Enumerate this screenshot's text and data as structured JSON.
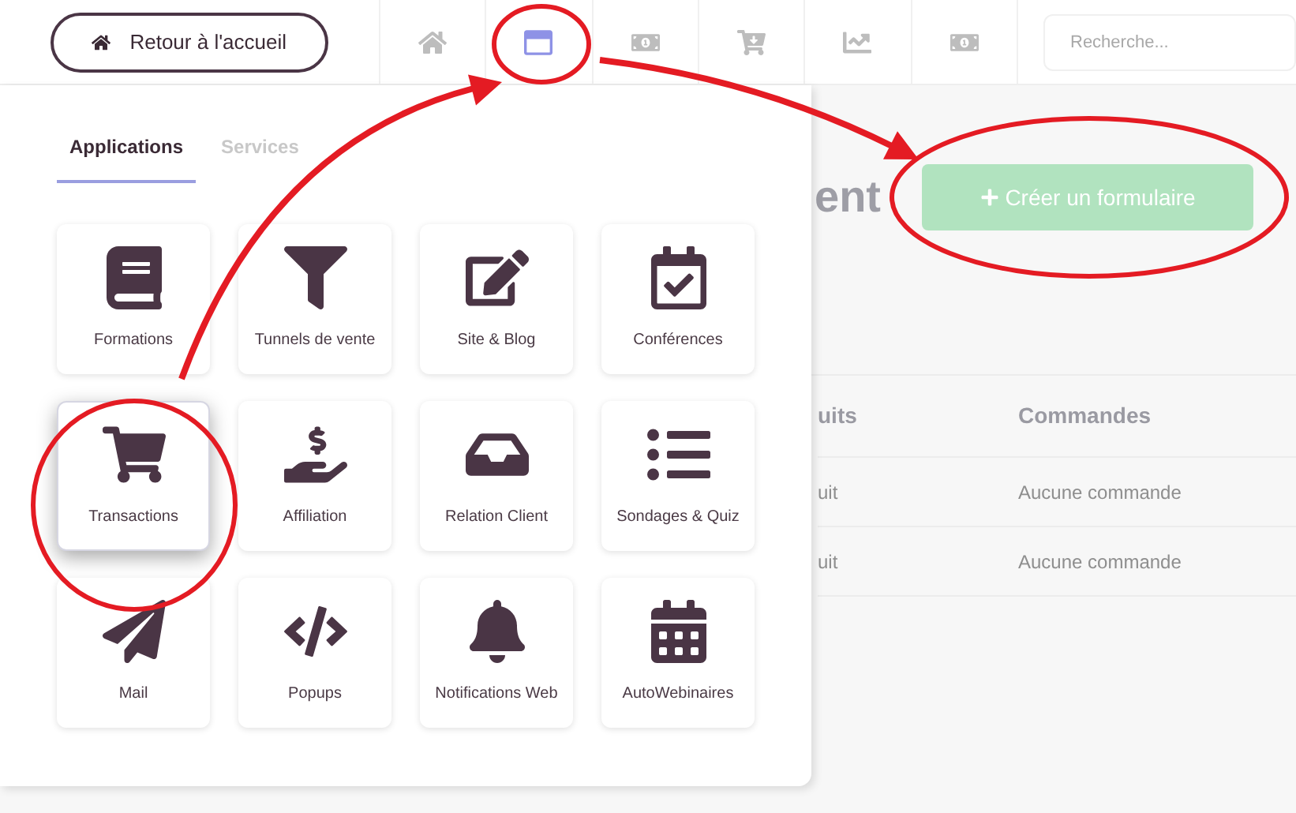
{
  "topbar": {
    "back_button": "Retour à l'accueil",
    "nav": [
      {
        "selected": false
      },
      {
        "selected": true
      },
      {
        "selected": false
      },
      {
        "selected": false
      },
      {
        "selected": false
      },
      {
        "selected": false
      }
    ],
    "search": {
      "placeholder": "Recherche..."
    }
  },
  "page": {
    "heading": "ent",
    "create_button": "Créer un formulaire",
    "columns": [
      "uits",
      "Commandes"
    ],
    "rows": [
      [
        "uit",
        "Aucune commande"
      ],
      [
        "uit",
        "Aucune commande"
      ]
    ]
  },
  "menu": {
    "tabs": [
      {
        "label": "Applications",
        "selected": true
      },
      {
        "label": "Services",
        "selected": false
      }
    ],
    "apps": [
      {
        "label": "Formations",
        "selected": false
      },
      {
        "label": "Tunnels de vente",
        "selected": false
      },
      {
        "label": "Site & Blog",
        "selected": false
      },
      {
        "label": "Conférences",
        "selected": false
      },
      {
        "label": "Transactions",
        "selected": true
      },
      {
        "label": "Affiliation",
        "selected": false
      },
      {
        "label": "Relation Client",
        "selected": false
      },
      {
        "label": "Sondages & Quiz",
        "selected": false
      },
      {
        "label": "Mail",
        "selected": false
      },
      {
        "label": "Popups",
        "selected": false
      },
      {
        "label": "Notifications Web",
        "selected": false
      },
      {
        "label": "AutoWebinaires",
        "selected": false
      }
    ]
  }
}
